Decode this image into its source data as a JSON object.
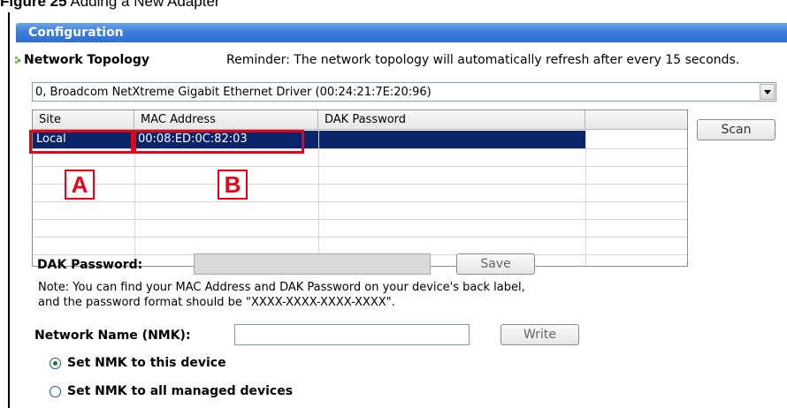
{
  "caption": {
    "figure_label": "Figure 25",
    "figure_title": "Adding a New Adapter"
  },
  "window": {
    "title": "Configuration"
  },
  "topology": {
    "label": "Network Topology",
    "reminder": "Reminder: The network topology will automatically refresh after every 15 seconds."
  },
  "adapter_select": {
    "selected": "0, Broadcom NetXtreme Gigabit Ethernet Driver (00:24:21:7E:20:96)"
  },
  "device_table": {
    "columns": [
      "Site",
      "MAC Address",
      "DAK Password",
      ""
    ],
    "rows": [
      {
        "site": "Local",
        "mac": "00:08:ED:0C:82:03",
        "dak": "",
        "selected": true
      }
    ]
  },
  "scan_button": {
    "label": "Scan"
  },
  "callouts": {
    "a": "A",
    "b": "B"
  },
  "highlight_color": "#e3001b",
  "dak": {
    "label": "DAK Password:",
    "value": "",
    "save_label": "Save",
    "note_line1": "Note: You can find your MAC Address and DAK Password on your device's back label,",
    "note_line2": "and the password format should be \"XXXX-XXXX-XXXX-XXXX\"."
  },
  "nmk": {
    "label": "Network Name (NMK):",
    "value": "",
    "write_label": "Write",
    "option_this_device": "Set NMK to this device",
    "option_all_devices": "Set NMK to all managed devices",
    "selected_option": "this_device"
  }
}
